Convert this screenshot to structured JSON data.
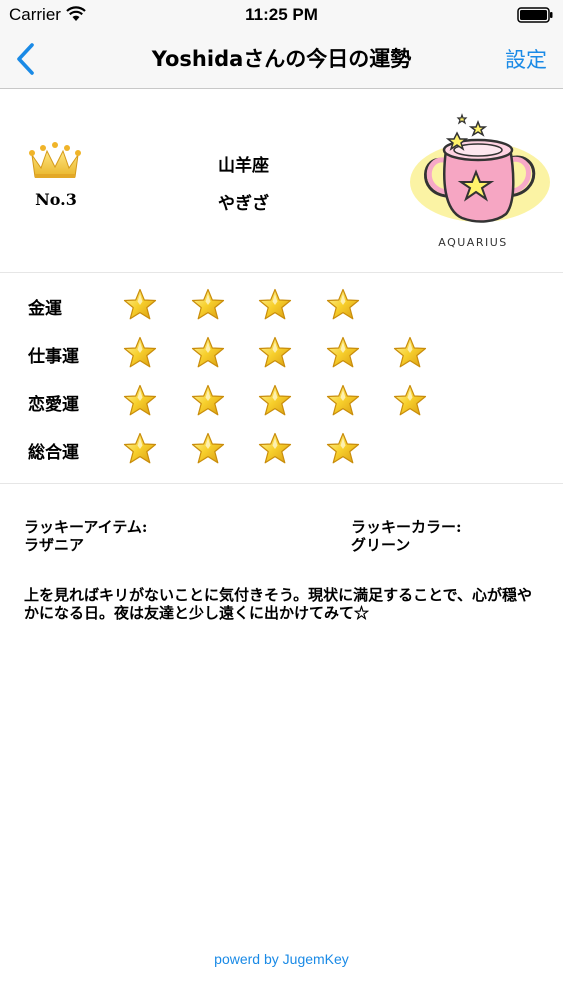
{
  "status_bar": {
    "carrier": "Carrier",
    "time": "11:25 PM"
  },
  "nav": {
    "title": "Yoshidaさんの今日の運勢",
    "settings_label": "設定",
    "accent_color": "#1a8ae6"
  },
  "ranking": {
    "label": "No.3",
    "icon": "crown-icon"
  },
  "sign": {
    "name": "山羊座",
    "reading": "やぎざ",
    "illustration_caption": "AQUARIUS",
    "illustration": "aquarius-water-jug-illustration"
  },
  "fortunes": [
    {
      "label": "金運",
      "stars": 4,
      "max": 5
    },
    {
      "label": "仕事運",
      "stars": 5,
      "max": 5
    },
    {
      "label": "恋愛運",
      "stars": 5,
      "max": 5
    },
    {
      "label": "総合運",
      "stars": 4,
      "max": 5
    }
  ],
  "lucky": {
    "item_title": "ラッキーアイテム:",
    "item_value": "ラザニア",
    "color_title": "ラッキーカラー:",
    "color_value": "グリーン"
  },
  "message": "上を見ればキリがないことに気付きそう。現状に満足することで、心が穏やかになる日。夜は友達と少し遠くに出かけてみて☆",
  "footer": {
    "link_text": "powerd by JugemKey"
  }
}
